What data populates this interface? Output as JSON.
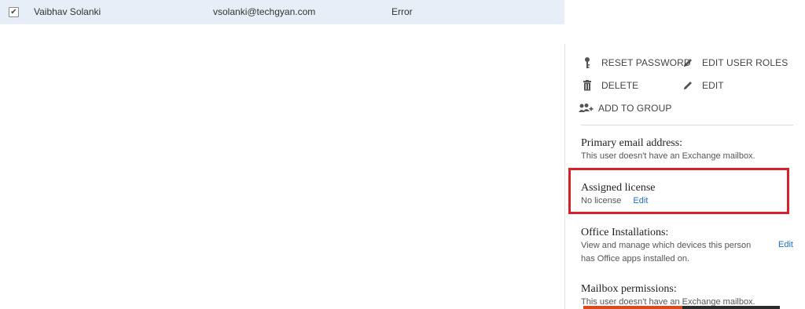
{
  "row": {
    "checked": "✔",
    "name": "Vaibhav Solanki",
    "email": "vsolanki@techgyan.com",
    "status": "Error"
  },
  "actions": {
    "reset_password": "RESET PASSWORD",
    "edit_user_roles": "EDIT USER ROLES",
    "delete": "DELETE",
    "edit": "EDIT",
    "add_to_group": "ADD TO GROUP"
  },
  "sections": {
    "email": {
      "title": "Primary email address:",
      "text": "This user doesn't have an Exchange mailbox."
    },
    "license": {
      "title": "Assigned license",
      "text": "No license",
      "link": "Edit"
    },
    "office": {
      "title": "Office Installations:",
      "text_line1": "View and manage which devices this person",
      "text_line2": "has Office apps installed on.",
      "link": "Edit"
    },
    "mailbox": {
      "title": "Mailbox permissions:",
      "text": "This user doesn't have an Exchange mailbox."
    }
  }
}
